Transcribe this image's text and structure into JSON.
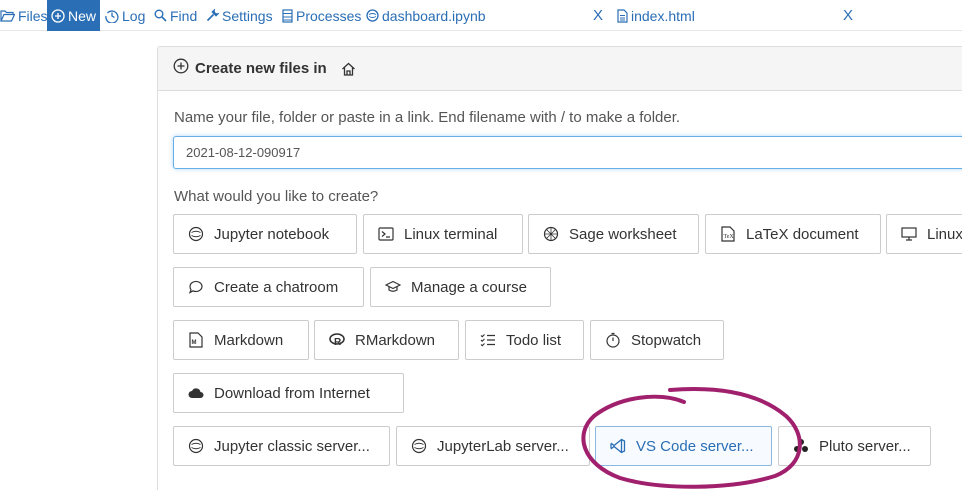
{
  "nav": {
    "files": "Files",
    "new": "New",
    "log": "Log",
    "find": "Find",
    "settings": "Settings",
    "processes": "Processes",
    "tab1": "dashboard.ipynb",
    "tab2": "index.html",
    "close": "X"
  },
  "panel": {
    "title": "Create new files in",
    "name_prompt": "Name your file, folder or paste in a link. End filename with / to make a folder.",
    "filename_value": "2021-08-12-090917",
    "create_prompt": "What would you like to create?"
  },
  "buttons": {
    "jupyter_notebook": "Jupyter notebook",
    "linux_terminal": "Linux terminal",
    "sage_worksheet": "Sage worksheet",
    "latex_document": "LaTeX document",
    "linux_cut": "Linux",
    "create_chatroom": "Create a chatroom",
    "manage_course": "Manage a course",
    "markdown": "Markdown",
    "rmarkdown": "RMarkdown",
    "todo_list": "Todo list",
    "stopwatch": "Stopwatch",
    "download_internet": "Download from Internet",
    "jupyter_classic": "Jupyter classic server...",
    "jupyterlab": "JupyterLab server...",
    "vscode": "VS Code server...",
    "pluto": "Pluto server..."
  },
  "colors": {
    "link": "#2a6eb5",
    "annotation": "#a0206e"
  }
}
